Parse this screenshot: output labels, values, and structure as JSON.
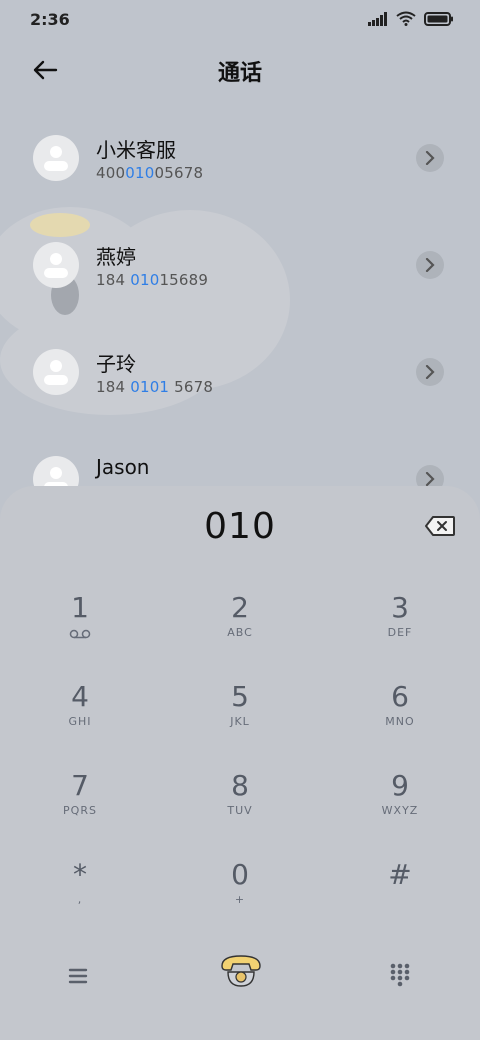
{
  "status_bar": {
    "time": "2:36"
  },
  "header": {
    "title": "通话",
    "back_icon": "back-arrow-icon"
  },
  "contacts": [
    {
      "name": "小米客服",
      "number_parts": [
        "400",
        "010",
        "05678"
      ]
    },
    {
      "name": "燕婷",
      "number_parts": [
        "184 ",
        "010",
        "15689"
      ]
    },
    {
      "name": "子玲",
      "number_parts": [
        "184 ",
        "0101",
        " 5678"
      ]
    },
    {
      "name": "Jason",
      "number_parts": [
        "",
        "",
        ""
      ]
    }
  ],
  "dialpad": {
    "input": "010",
    "keys": [
      {
        "main": "1",
        "sub": "voicemail"
      },
      {
        "main": "2",
        "sub": "ABC"
      },
      {
        "main": "3",
        "sub": "DEF"
      },
      {
        "main": "4",
        "sub": "GHI"
      },
      {
        "main": "5",
        "sub": "JKL"
      },
      {
        "main": "6",
        "sub": "MNO"
      },
      {
        "main": "7",
        "sub": "PQRS"
      },
      {
        "main": "8",
        "sub": "TUV"
      },
      {
        "main": "9",
        "sub": "WXYZ"
      },
      {
        "main": "*",
        "sub": ","
      },
      {
        "main": "0",
        "sub": "+"
      },
      {
        "main": "#",
        "sub": ""
      }
    ]
  },
  "colors": {
    "highlight": "#2f7ee6",
    "background": "#bfc4cc",
    "dialpad_bg": "#c4c7cd",
    "call_button": "#f2d272"
  }
}
